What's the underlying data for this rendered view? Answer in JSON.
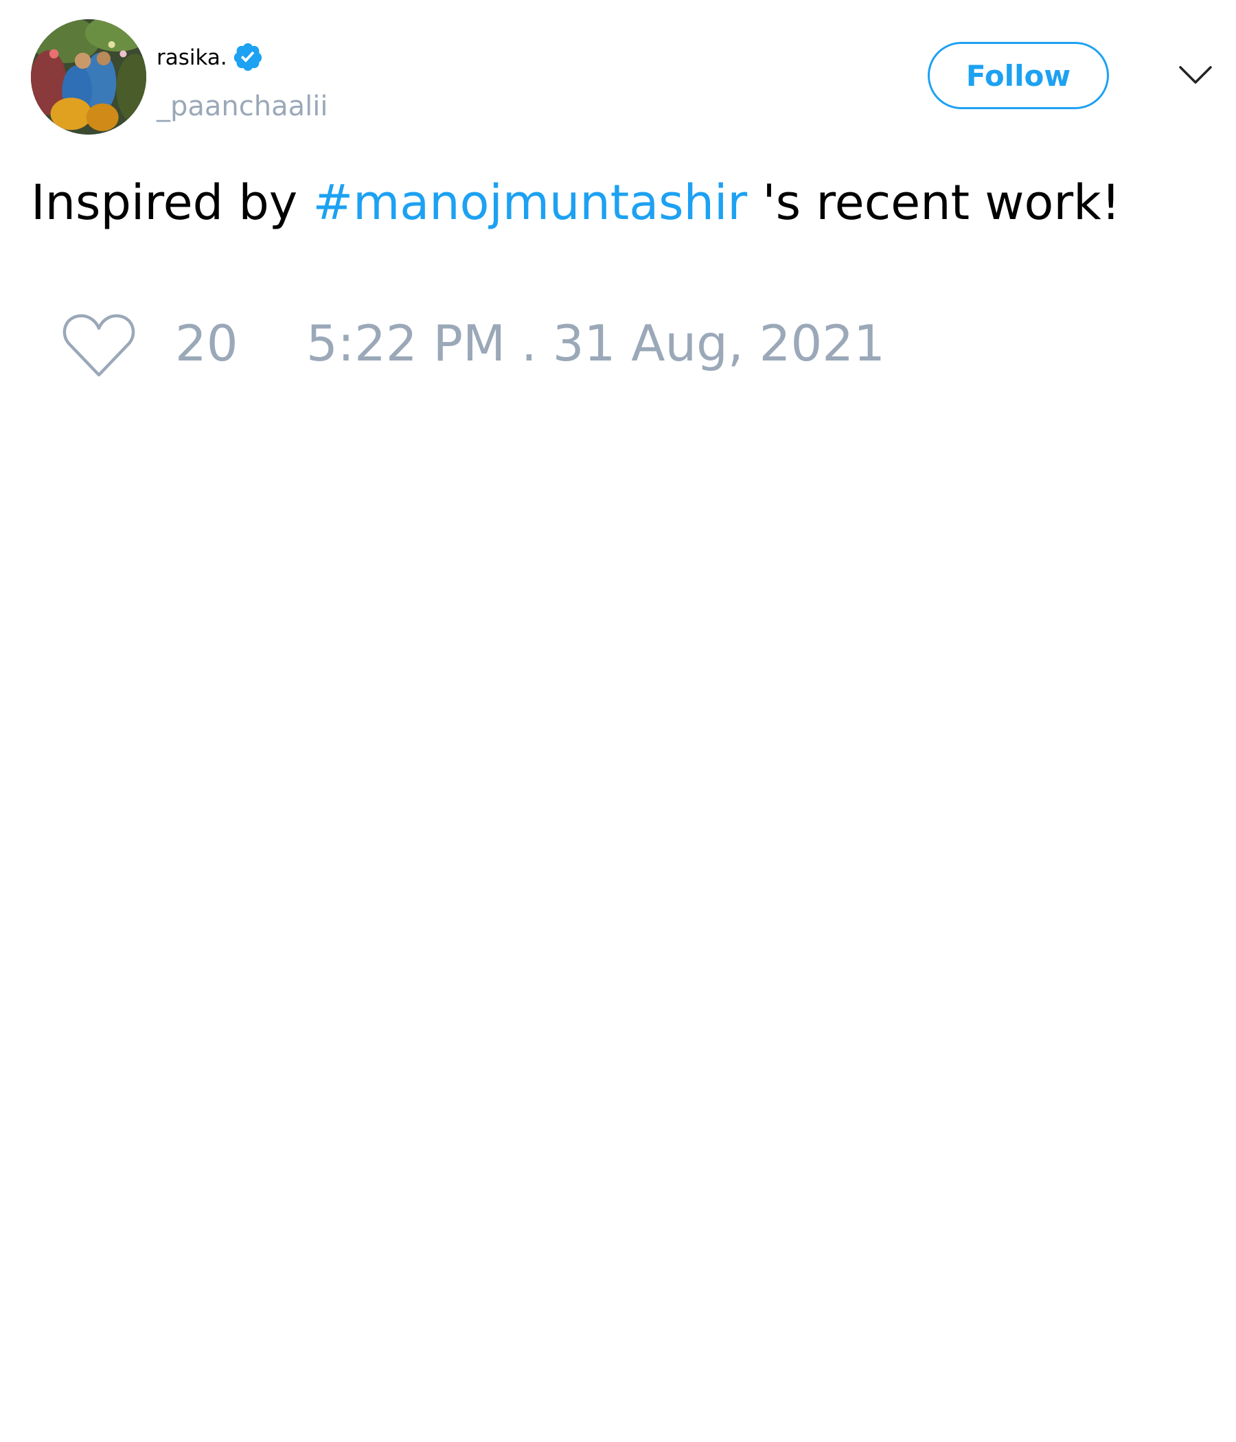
{
  "user": {
    "display_name": "rasika.",
    "handle": "_paanchaalii",
    "verified": true,
    "verified_icon": "verified-badge-icon"
  },
  "actions": {
    "follow_label": "Follow",
    "menu_icon": "chevron-down-icon"
  },
  "tweet": {
    "text_before": "Inspired by ",
    "hashtag": "#manojmuntashir",
    "text_after": " 's recent work!"
  },
  "footer": {
    "like_icon": "heart-icon",
    "like_count": "20",
    "timestamp": "5:22 PM . 31 Aug, 2021"
  },
  "colors": {
    "accent": "#1da1f2",
    "muted": "#9aa8b8",
    "text": "#000000",
    "background": "#ffffff"
  }
}
